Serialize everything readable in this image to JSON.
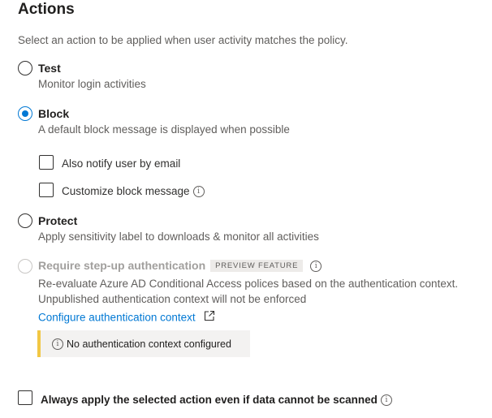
{
  "header": {
    "title": "Actions",
    "description": "Select an action to be applied when user activity matches the policy."
  },
  "options": {
    "test": {
      "label": "Test",
      "description": "Monitor login activities",
      "selected": false
    },
    "block": {
      "label": "Block",
      "description": "A default block message is displayed when possible",
      "selected": true
    },
    "protect": {
      "label": "Protect",
      "description": "Apply sensitivity label to downloads & monitor all activities",
      "selected": false
    },
    "stepup": {
      "label": "Require step-up authentication",
      "badge": "PREVIEW FEATURE",
      "description_line1": "Re-evaluate Azure AD Conditional Access polices based on the authentication context.",
      "description_line2": "Unpublished authentication context will not be enforced",
      "link": "Configure authentication context",
      "disabled": true
    }
  },
  "block_options": {
    "notify_email": {
      "label": "Also notify user by email",
      "checked": false
    },
    "customize_message": {
      "label": "Customize block message",
      "checked": false
    }
  },
  "message_bar": {
    "text": "No authentication context configured"
  },
  "always_apply": {
    "label": "Always apply the selected action even if data cannot be scanned",
    "checked": false
  },
  "colors": {
    "accent": "#0078d4",
    "warning": "#f2c744"
  },
  "icons": [
    "info-icon",
    "external-link-icon"
  ]
}
